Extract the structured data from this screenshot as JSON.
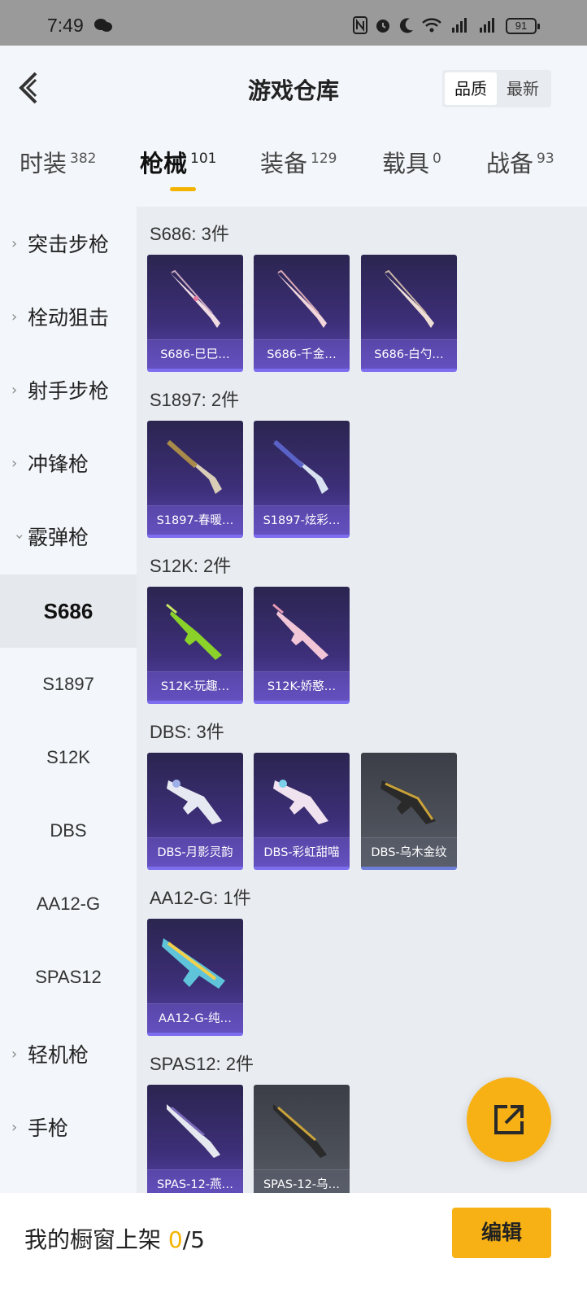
{
  "status_bar": {
    "time": "7:49",
    "battery": "91"
  },
  "header": {
    "title": "游戏仓库",
    "sort_options": [
      "品质",
      "最新"
    ],
    "sort_active": "品质"
  },
  "tabs": [
    {
      "label": "时装",
      "count": "382"
    },
    {
      "label": "枪械",
      "count": "101"
    },
    {
      "label": "装备",
      "count": "129"
    },
    {
      "label": "载具",
      "count": "0"
    },
    {
      "label": "战备",
      "count": "93"
    }
  ],
  "sidebar": {
    "categories": [
      "突击步枪",
      "栓动狙击",
      "射手步枪",
      "冲锋枪",
      "霰弹枪",
      "轻机枪",
      "手枪"
    ],
    "subcategories": [
      "S686",
      "S1897",
      "S12K",
      "DBS",
      "AA12-G",
      "SPAS12"
    ],
    "active_sub": "S686"
  },
  "sections": [
    {
      "title": "S686: 3件",
      "items": [
        "S686-巳巳…",
        "S686-千金…",
        "S686-白勺…"
      ]
    },
    {
      "title": "S1897: 2件",
      "items": [
        "S1897-春暖…",
        "S1897-炫彩…"
      ]
    },
    {
      "title": "S12K: 2件",
      "items": [
        "S12K-玩趣…",
        "S12K-娇憨…"
      ]
    },
    {
      "title": "DBS: 3件",
      "items": [
        "DBS-月影灵韵",
        "DBS-彩虹甜喵",
        "DBS-乌木金纹"
      ]
    },
    {
      "title": "AA12-G: 1件",
      "items": [
        "AA12-G-纯…"
      ]
    },
    {
      "title": "SPAS12: 2件",
      "items": [
        "SPAS-12-燕…",
        "SPAS-12-乌…"
      ]
    }
  ],
  "bottom_bar": {
    "label": "我的橱窗上架 ",
    "current": "0",
    "total": "/5",
    "edit_label": "编辑"
  },
  "colors": {
    "accent": "#f7b114",
    "card_purple": "#3d2f79",
    "card_grey": "#4b4f58"
  },
  "icons": {
    "back": "back-arrow-icon",
    "share": "share-external-icon",
    "chevron": "chevron-right-icon"
  }
}
